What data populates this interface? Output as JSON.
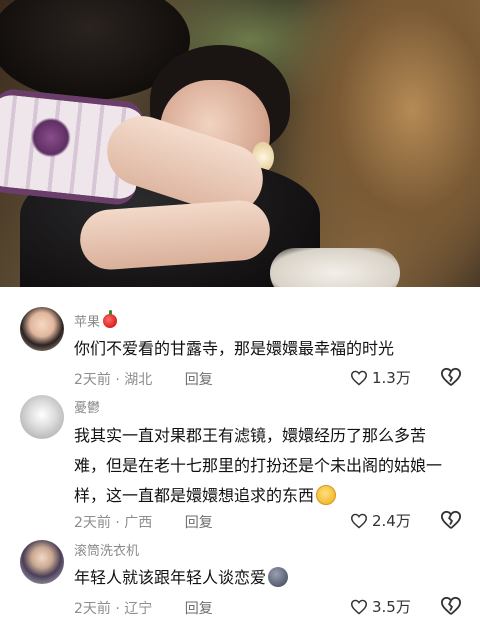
{
  "comments": [
    {
      "username": "苹果",
      "has_apple_badge": true,
      "text": "你们不爱看的甘露寺，那是嬛嬛最幸福的时光",
      "emoji": "",
      "time": "2天前",
      "location": "湖北",
      "reply_label": "回复",
      "likes": "1.3万"
    },
    {
      "username": "憂鬱",
      "has_apple_badge": false,
      "text": "我其实一直对果郡王有滤镜，嬛嬛经历了那么多苦难，但是在老十七那里的打扮还是个未出阁的姑娘一样，这一直都是嬛嬛想追求的东西",
      "emoji": "grin-tears",
      "time": "2天前",
      "location": "广西",
      "reply_label": "回复",
      "likes": "2.4万"
    },
    {
      "username": "滚筒洗衣机",
      "has_apple_badge": false,
      "text": "年轻人就该跟年轻人谈恋爱",
      "emoji": "grey-blob",
      "time": "2天前",
      "location": "辽宁",
      "reply_label": "回复",
      "likes": "3.5万"
    }
  ],
  "icons": {
    "like": "heart-outline-icon",
    "dislike": "broken-heart-icon"
  }
}
